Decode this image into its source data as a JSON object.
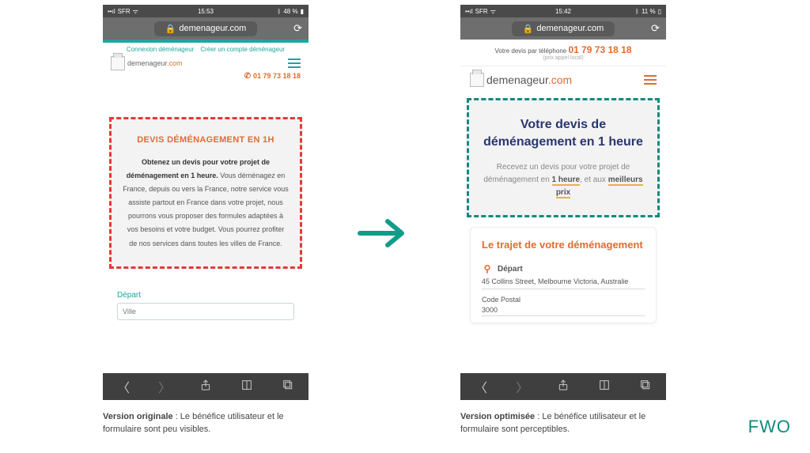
{
  "status_left": {
    "carrier": "SFR",
    "wifi": "⋮⋮",
    "time": "15:53",
    "bt": "✱",
    "batt": "48 %"
  },
  "status_right": {
    "carrier": "SFR",
    "wifi": "⋮⋮",
    "time": "15:42",
    "bt": "✱",
    "batt": "11 %"
  },
  "url": "demenageur.com",
  "left": {
    "toplink1": "Connexion déménageur",
    "toplink2": "Créer un compte déménageur",
    "logo_a": "demenageur",
    "logo_b": ".com",
    "phone": "01 79 73 18 18",
    "hero_title": "DEVIS DÉMÉNAGEMENT EN 1H",
    "hero_bold": "Obtenez un devis pour votre projet de déménagement en 1 heure.",
    "hero_rest": " Vous déménagez en France, depuis ou vers la France, notre service vous assiste partout en France dans votre projet, nous pourrons vous proposer des formules adaptées à vos besoins et votre budget. Vous pourrez profiter de nos services dans toutes les villes de France.",
    "depart_label": "Départ",
    "depart_placeholder": "Ville"
  },
  "right": {
    "topband_pre": "Votre devis par téléphone ",
    "topband_num": "01 79 73 18 18",
    "topband_sub": "(prix appel local)",
    "logo_a": "demenageur",
    "logo_b": ".com",
    "hero_title": "Votre devis de déménagement en 1 heure",
    "hero_p_a": "Recevez un devis pour votre projet de déménagement en ",
    "hero_p_b": "1 heure",
    "hero_p_c": ", et aux ",
    "hero_p_d": "meilleurs prix",
    "card_title": "Le trajet de votre déménagement",
    "depart_label": "Départ",
    "addr": "45 Collins Street, Melbourne Victoria, Australie",
    "cp_label": "Code Postal",
    "cp_value": "3000"
  },
  "captions": {
    "left_b": "Version originale",
    "left_t": " : Le bénéfice utilisateur et le formulaire sont peu visibles.",
    "right_b": "Version optimisée",
    "right_t": " : Le bénéfice utilisateur et le formulaire sont perceptibles."
  },
  "fwo": "FWO"
}
